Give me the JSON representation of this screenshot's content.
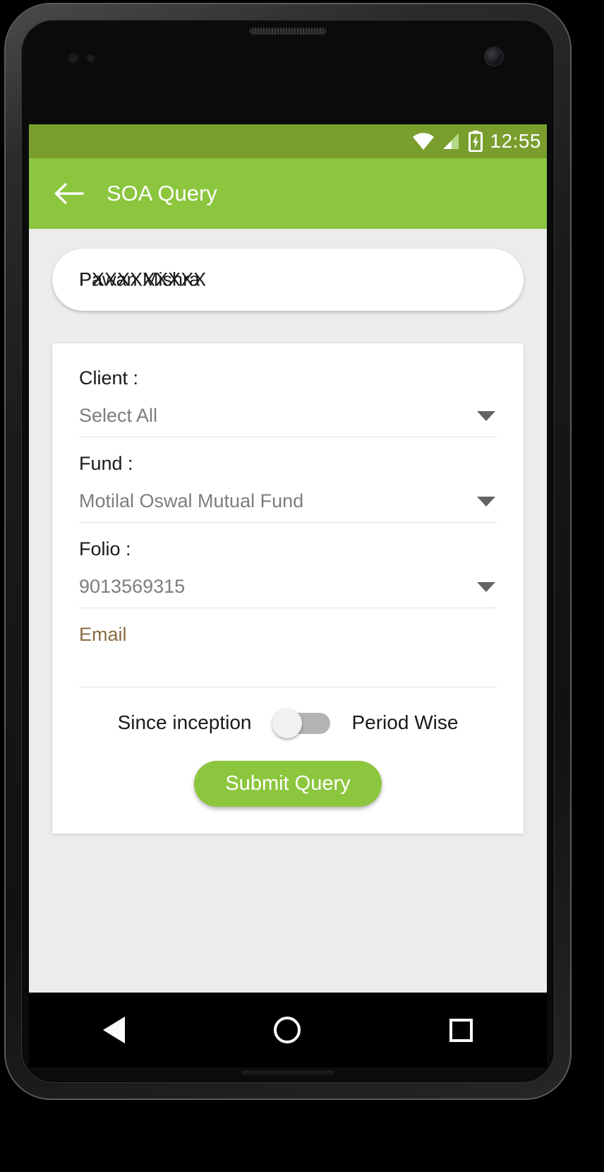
{
  "status_bar": {
    "time": "12:55",
    "icons": [
      "wifi-icon",
      "signal-icon",
      "battery-charging-icon"
    ],
    "background": "#7a9e2e"
  },
  "app_bar": {
    "back_label": "back-arrow",
    "title": "SOA Query",
    "background": "#8cc63e"
  },
  "search_pill": {
    "primary_text": "Pawan Mishra",
    "overlay_text": "PXXXXXXXXX"
  },
  "form": {
    "fields": [
      {
        "label": "Client :",
        "value": "Select All"
      },
      {
        "label": "Fund :",
        "value": "Motilal Oswal Mutual Fund"
      },
      {
        "label": "Folio :",
        "value": "9013569315"
      }
    ],
    "email": {
      "label": "Email",
      "value": "",
      "color": "#8a6a42"
    },
    "toggle": {
      "left_label": "Since inception",
      "right_label": "Period Wise",
      "state": "off",
      "track_color": "#b4b4b4",
      "thumb_color": "#f1f1f1"
    },
    "submit_label": "Submit Query",
    "submit_color": "#8cc63e"
  },
  "nav_bar": {
    "back": "triangle-back-icon",
    "home": "circle-home-icon",
    "recents": "square-recents-icon"
  }
}
